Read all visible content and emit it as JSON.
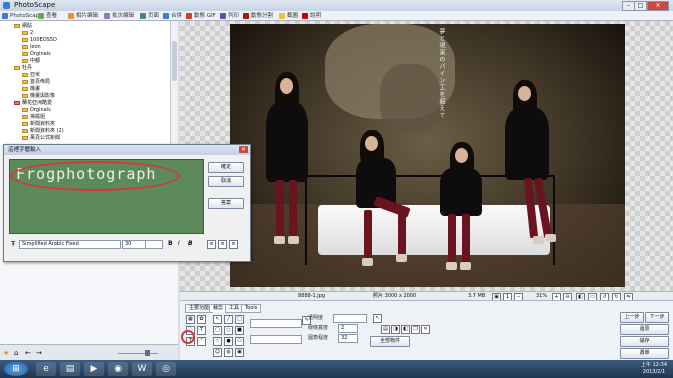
{
  "window": {
    "title": "PhotoScape",
    "min": "–",
    "max": "□",
    "close": "✕"
  },
  "tabs": [
    "PhotoScape",
    "查看",
    "相片编辑",
    "批次编辑",
    "页面",
    "合併",
    "動態 GIF",
    "列印",
    "動態分割",
    "截圖",
    "說明"
  ],
  "tree": {
    "items": [
      "網貼",
      "2",
      "100EOS5D",
      "leon",
      "Orginals",
      "中都",
      "牡丹",
      "亞米",
      "首頁佈局",
      "機畫",
      "機畫與影像",
      "蘭花亞洲酷愛",
      "Orginals",
      "孫榆姐",
      "新聞資料夾",
      "新聞資料夾 (2)",
      "萬頁公式新聞"
    ]
  },
  "dialog": {
    "title": "這裡字體輸入",
    "close": "✕",
    "text_value": "Frogphotograph",
    "ok": "確定",
    "cancel": "取消",
    "default": "答案",
    "font": "Simplified Arabic Fixed",
    "size": "30",
    "style_bold": "B",
    "style_italic": "I",
    "style_both": "B"
  },
  "photo": {
    "vertical_text": "夢と現実のパイン工を超えて"
  },
  "status": {
    "file": "8888-1.jpg",
    "dimensions": "照片 3000 x 2000",
    "filesize": "3.7 MB",
    "zoom": "31%"
  },
  "panel": {
    "tabs": [
      "主要功能",
      "裁剪",
      "工具",
      "Tools"
    ],
    "label_opacity": "透明度",
    "label_linewidth": "線條寬度",
    "label_radius": "圓角程度",
    "val_linewidth": "2",
    "val_radius": "32",
    "btn_apply": "全部物件",
    "btn_prev": "上一步",
    "btn_next": "下一步",
    "btn_restore": "還原",
    "btn_save": "儲存",
    "btn_menu": "選單"
  },
  "clock": {
    "time": "上午 12:34",
    "date": "2013/2/1"
  },
  "colors": {
    "accent": "#d23a3a",
    "textbox_bg": "#5d8a5d",
    "taskbar": "#2c4766"
  }
}
